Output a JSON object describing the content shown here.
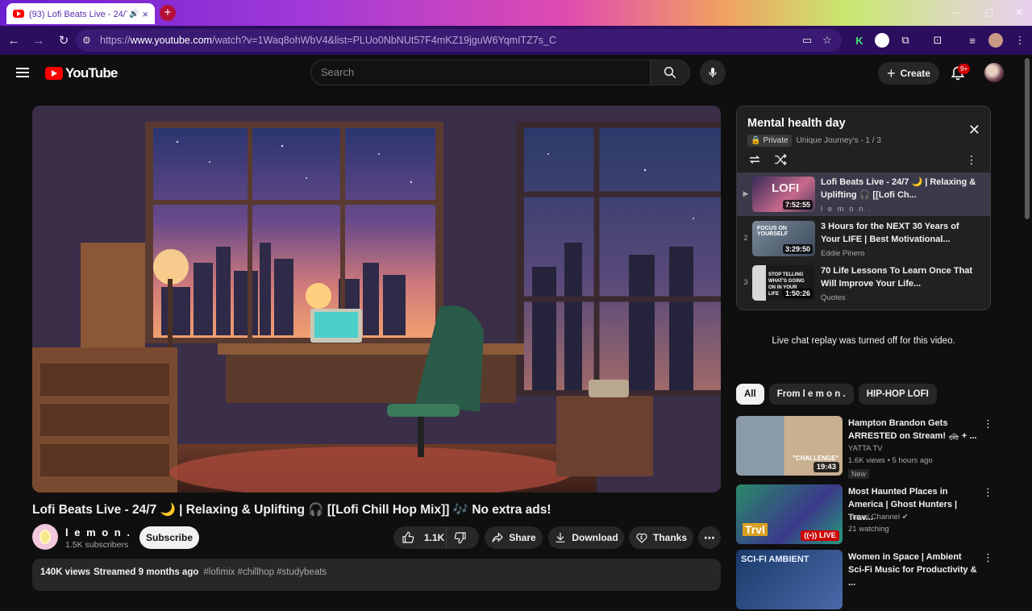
{
  "browser": {
    "tab_title": "(93) Lofi Beats Live - 24/7 🌙",
    "tab_close": "×",
    "new_tab": "+",
    "url_prefix": "https://",
    "url_host": "www.youtube.com",
    "url_path": "/watch?v=1Waq8ohWbV4&list=PLUo0NbNUt57F4mKZ19jguW6YqmITZ7s_C"
  },
  "header": {
    "logo": "YouTube",
    "search_placeholder": "Search",
    "create_label": "Create",
    "notif_count": "9+"
  },
  "video": {
    "title": "Lofi Beats Live - 24/7 🌙 | Relaxing & Uplifting 🎧 [[Lofi Chill Hop Mix]] 🎶 No extra ads!",
    "channel": "l e m o n .",
    "subscribers": "1.5K subscribers",
    "subscribe_label": "Subscribe",
    "likes": "1.1K",
    "share_label": "Share",
    "download_label": "Download",
    "thanks_label": "Thanks",
    "more_label": "⋯",
    "desc_views": "140K views",
    "desc_streamed": "Streamed 9 months ago",
    "desc_tags": "#lofimix #chillhop #studybeats"
  },
  "playlist": {
    "title": "Mental health day",
    "privacy": "Private",
    "owner_progress": "Unique Journey's  -  1 / 3",
    "items": [
      {
        "index": "▶",
        "title": "Lofi Beats Live - 24/7 🌙 | Relaxing & Uplifting 🎧 [[Lofi Ch...",
        "channel": "l e m o n .",
        "duration": "7:52:55"
      },
      {
        "index": "2",
        "title": "3 Hours for the NEXT 30 Years of Your LIFE | Best Motivational...",
        "channel": "Eddie Pinero",
        "duration": "3:29:50"
      },
      {
        "index": "3",
        "title": "70 Life Lessons To Learn Once That Will Improve Your Life...",
        "channel": "Quotes",
        "duration": "1:50:26"
      }
    ]
  },
  "chat_note": "Live chat replay was turned off for this video.",
  "chips": [
    "All",
    "From l e m o n .",
    "HIP-HOP LOFI"
  ],
  "recommendations": [
    {
      "title": "Hampton Brandon Gets ARRESTED on Stream! 🚓 + ...",
      "channel": "YATTA TV",
      "views": "1.6K views • 5 hours ago",
      "duration": "19:43",
      "badge": "New"
    },
    {
      "title": "Most Haunted Places in America | Ghost Hunters | Trav...",
      "channel": "Travel Channel ✔",
      "views": "21 watching",
      "live": "((•)) LIVE"
    },
    {
      "title": "Women in Space | Ambient Sci-Fi Music for Productivity & ...",
      "channel": "",
      "views": ""
    }
  ],
  "thumb_texts": {
    "pl1": "LOFI",
    "pl2": "FOCUS ON YOURSELF",
    "pl3": "STOP TELLING WHAT'S GOING ON IN YOUR LIFE",
    "rec1": "\"CHALLENGE\"",
    "rec2": "Trvl",
    "rec3": "SCI-FI AMBIENT"
  }
}
